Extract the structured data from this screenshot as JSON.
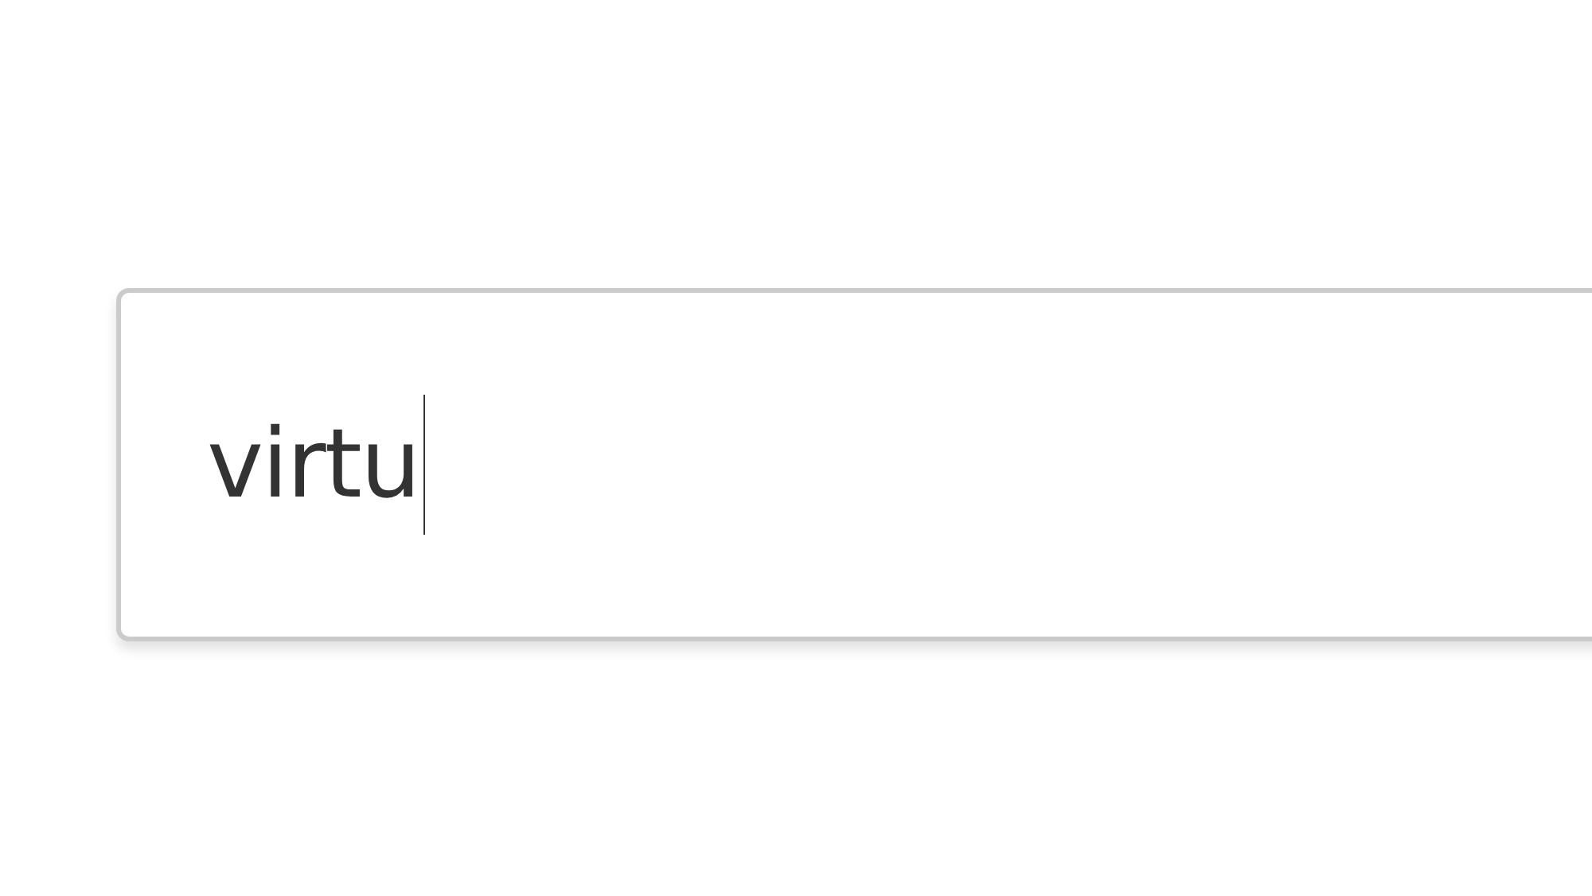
{
  "field": {
    "value": "virtu",
    "focused": true
  }
}
